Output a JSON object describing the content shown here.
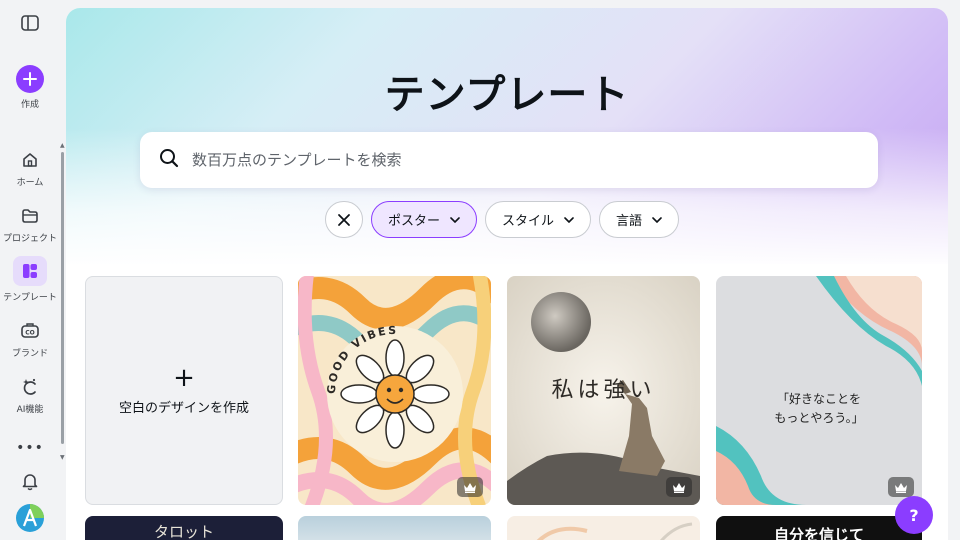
{
  "sidebar": {
    "items": [
      {
        "label": "作成",
        "icon": "plus-icon"
      },
      {
        "label": "ホーム",
        "icon": "home-icon"
      },
      {
        "label": "プロジェクト",
        "icon": "folder-icon"
      },
      {
        "label": "テンプレート",
        "icon": "template-icon"
      },
      {
        "label": "ブランド",
        "icon": "brand-icon"
      },
      {
        "label": "AI機能",
        "icon": "ai-sparkle-icon"
      }
    ],
    "more": "•••"
  },
  "hero": {
    "title": "テンプレート"
  },
  "search": {
    "placeholder": "数百万点のテンプレートを検索"
  },
  "filters": [
    {
      "label": "ポスター",
      "active": true
    },
    {
      "label": "スタイル",
      "active": false
    },
    {
      "label": "言語",
      "active": false
    }
  ],
  "blank_card": {
    "label": "空白のデザインを作成"
  },
  "templates": [
    {
      "text": "GOOD VIBES",
      "premium": true
    },
    {
      "text": "私は強い",
      "premium": true
    },
    {
      "line1": "「好きなことを",
      "line2": "もっとやろう。」",
      "premium": true
    }
  ],
  "bottom_row": [
    {
      "text": "タロット"
    },
    {
      "text": ""
    },
    {
      "text": ""
    },
    {
      "text": "自分を信じて"
    }
  ],
  "help": {
    "label": "?"
  },
  "colors": {
    "accent": "#8b3dff",
    "chip_active_bg": "#efe6ff"
  }
}
